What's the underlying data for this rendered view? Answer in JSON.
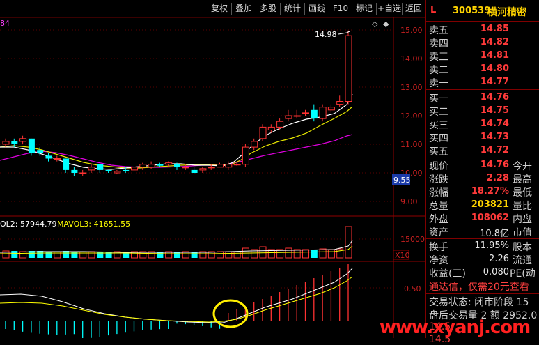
{
  "toolbar": {
    "items": [
      "复权",
      "叠加",
      "多股",
      "统计",
      "画线",
      "F10",
      "标记",
      "+自选",
      "返回"
    ]
  },
  "header": {
    "market_flag": "L",
    "code": "300539",
    "name": "横河精密"
  },
  "chart": {
    "top_left_fragment": "84",
    "high_label": "14.98",
    "current_price_tag": "9.55",
    "price_axis": [
      "15.00",
      "14.00",
      "13.00",
      "12.00",
      "11.00",
      "10.00",
      "9.00"
    ],
    "volume_legend_a": "OL2: 57944.79",
    "volume_legend_b": "MAVOL3: 41651.55",
    "volume_axis": "15000",
    "volume_unit": "X10",
    "indicator_axis": "0.50",
    "colors": {
      "up": "#ff3232",
      "down": "#00ffff",
      "ma5": "#ffffff",
      "ma10": "#ffff00",
      "ma20": "#ff00ff",
      "annotation": "#ffff00"
    }
  },
  "order_book": {
    "sell": [
      {
        "label": "卖五",
        "price": "14.85"
      },
      {
        "label": "卖四",
        "price": "14.82"
      },
      {
        "label": "卖三",
        "price": "14.81"
      },
      {
        "label": "卖二",
        "price": "14.80"
      },
      {
        "label": "卖一",
        "price": "14.77"
      }
    ],
    "buy": [
      {
        "label": "买一",
        "price": "14.76"
      },
      {
        "label": "买二",
        "price": "14.75"
      },
      {
        "label": "买三",
        "price": "14.74"
      },
      {
        "label": "买四",
        "price": "14.73"
      },
      {
        "label": "买五",
        "price": "14.72"
      }
    ]
  },
  "quote": [
    {
      "label": "现价",
      "value": "14.76",
      "label2": "今开"
    },
    {
      "label": "涨跌",
      "value": "2.28",
      "label2": "最高"
    },
    {
      "label": "涨幅",
      "value": "18.27%",
      "label2": "最低"
    },
    {
      "label": "总量",
      "value": "203821",
      "label2": "量比"
    },
    {
      "label": "外盘",
      "value": "108062",
      "label2": "内盘"
    },
    {
      "label": "资产",
      "value": "10.8亿",
      "label2": "市值"
    }
  ],
  "stats": [
    {
      "label": "换手",
      "value": "11.95%",
      "label2": "股本"
    },
    {
      "label": "净资",
      "value": "2.26",
      "label2": "流通"
    },
    {
      "label": "收益(三)",
      "value": "0.080",
      "label2": "PE(动"
    }
  ],
  "promo": "通达信，仅需20元查看",
  "status": {
    "line1": "交易状态: 闭市阶段 15",
    "line2": "盘后交易量 2 额 2952.0",
    "trades": [
      "14.5",
      "14.5"
    ]
  },
  "watermark": "www.xyanj.com"
}
